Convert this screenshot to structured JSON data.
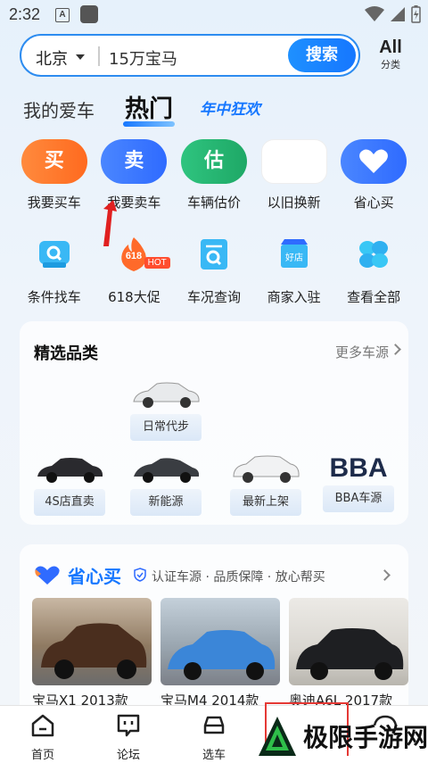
{
  "status_bar": {
    "time": "2:32",
    "notif_letter": "A"
  },
  "search": {
    "city": "北京",
    "query": "15万宝马",
    "button_label": "搜索",
    "all_label": "All",
    "category_label": "分类"
  },
  "tabs": {
    "mine": "我的爱车",
    "hot": "热门",
    "promo": "年中狂欢"
  },
  "services_row1": [
    {
      "label": "我要买车",
      "icon_text": "买",
      "color": "#ff7a2e"
    },
    {
      "label": "我要卖车",
      "icon_text": "卖",
      "color": "#2f6bff"
    },
    {
      "label": "车辆估价",
      "icon_text": "估",
      "color": "#22b573"
    },
    {
      "label": "以旧换新",
      "icon_text": "",
      "color": "#ffffff"
    },
    {
      "label": "省心买",
      "icon_text": "",
      "color": "#2f6bff"
    }
  ],
  "services_row2": [
    {
      "label": "条件找车",
      "icon": "car-search-icon"
    },
    {
      "label": "618大促",
      "icon": "618-flame-icon",
      "icon_text": "618",
      "badge": "HOT"
    },
    {
      "label": "车况查询",
      "icon": "report-search-icon"
    },
    {
      "label": "商家入驻",
      "icon": "store-icon",
      "icon_text": "好店"
    },
    {
      "label": "查看全部",
      "icon": "grid-icon"
    }
  ],
  "featured": {
    "title": "精选品类",
    "more": "更多车源",
    "top_tile": "日常代步",
    "tiles": [
      "4S店直卖",
      "新能源",
      "最新上架",
      "BBA车源"
    ],
    "bba_text": "BBA"
  },
  "shengxin": {
    "title": "省心买",
    "desc": "认证车源 · 品质保障 · 放心帮买",
    "cars": [
      "宝马X1 2013款",
      "宝马M4 2014款",
      "奥迪A6L 2017款"
    ]
  },
  "bottom_nav": [
    "首页",
    "论坛",
    "选车"
  ],
  "watermark": "极限手游网"
}
